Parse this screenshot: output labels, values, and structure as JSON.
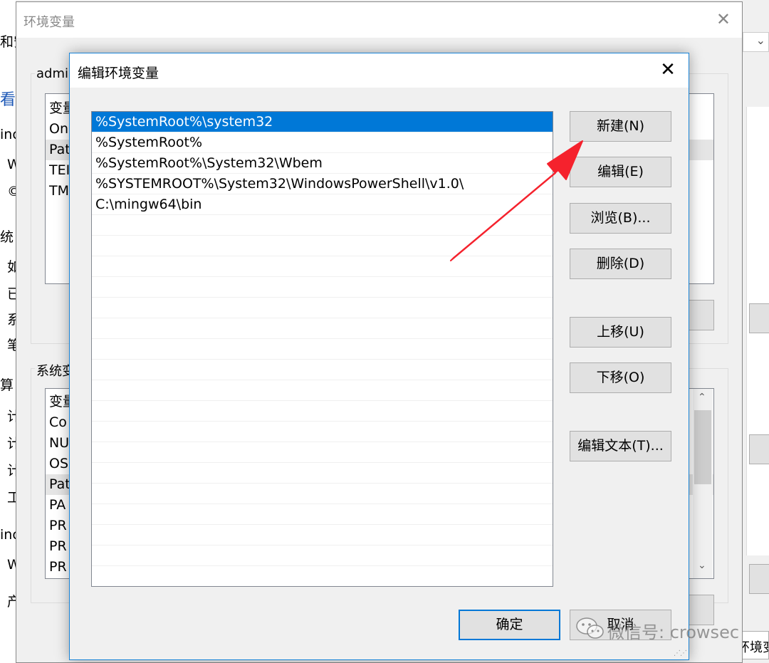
{
  "background": {
    "left_fragments": [
      "和安",
      "看",
      "inc",
      "W",
      "©",
      "统",
      "如",
      "已",
      "系",
      "笔",
      "算",
      "计",
      "计",
      "计",
      "工",
      "inc",
      "W",
      "产"
    ],
    "right_fragment": "环境变"
  },
  "env_window": {
    "title": "环境变量",
    "close_glyph": "✕",
    "user_group_label": "admi",
    "user_vars": [
      "变量",
      "On",
      "Pat",
      "TEI",
      "TM"
    ],
    "system_group_label": "系统变",
    "system_vars": [
      "变量",
      "Co",
      "NU",
      "OS",
      "Pat",
      "PA",
      "PR",
      "PR",
      "PR"
    ]
  },
  "dialog": {
    "title": "编辑环境变量",
    "close_glyph": "✕",
    "paths": [
      "%SystemRoot%\\system32",
      "%SystemRoot%",
      "%SystemRoot%\\System32\\Wbem",
      "%SYSTEMROOT%\\System32\\WindowsPowerShell\\v1.0\\",
      "C:\\mingw64\\bin"
    ],
    "selected_index": 0,
    "buttons": {
      "new": "新建(N)",
      "edit": "编辑(E)",
      "browse": "浏览(B)...",
      "delete": "删除(D)",
      "move_up": "上移(U)",
      "move_down": "下移(O)",
      "edit_text": "编辑文本(T)...",
      "ok": "确定",
      "cancel": "取消"
    }
  },
  "watermark": {
    "text": "微信号: crowsec"
  },
  "annotation": {
    "arrow_color": "#f5222d"
  }
}
